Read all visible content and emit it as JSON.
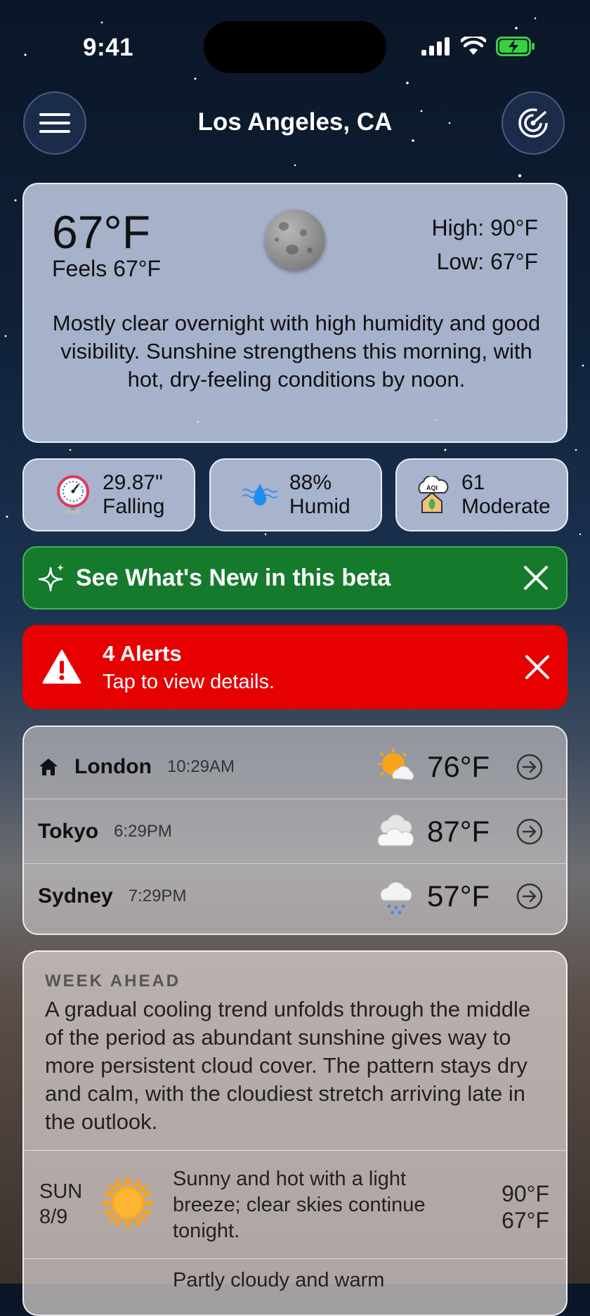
{
  "status": {
    "time": "9:41"
  },
  "header": {
    "city": "Los Angeles, CA"
  },
  "current": {
    "temp": "67°F",
    "feels": "Feels 67°F",
    "high": "High: 90°F",
    "low": "Low: 67°F",
    "summary": "Mostly clear overnight with high humidity and good visibility. Sunshine strengthens this morning, with hot, dry-feeling conditions by noon."
  },
  "metrics": [
    {
      "value": "29.87\"",
      "label": "Falling",
      "icon": "barometer-icon"
    },
    {
      "value": "88%",
      "label": "Humid",
      "icon": "humidity-drop-icon"
    },
    {
      "value": "61",
      "label": "Moderate",
      "icon": "aqi-icon"
    }
  ],
  "aqi_icon_text": "AQI",
  "beta_banner": {
    "text": "See What's New in this beta"
  },
  "alert_banner": {
    "title": "4 Alerts",
    "subtitle": "Tap to view details."
  },
  "cities": [
    {
      "name": "London",
      "time": "10:29AM",
      "temp": "76°F",
      "icon": "partly-sunny-icon",
      "home": true
    },
    {
      "name": "Tokyo",
      "time": "6:29PM",
      "temp": "87°F",
      "icon": "cloudy-icon",
      "home": false
    },
    {
      "name": "Sydney",
      "time": "7:29PM",
      "temp": "57°F",
      "icon": "rain-cloud-icon",
      "home": false
    }
  ],
  "week_ahead": {
    "heading": "WEEK AHEAD",
    "summary": "A gradual cooling trend unfolds through the middle of the period as abundant sunshine gives way to more persistent cloud cover. The pattern stays dry and calm, with the cloudiest stretch arriving late in the outlook.",
    "days": [
      {
        "day": "SUN",
        "date": "8/9",
        "desc": "Sunny and hot with a light breeze; clear skies continue tonight.",
        "high": "90°F",
        "low": "67°F",
        "icon": "sun-icon"
      },
      {
        "desc": "Partly cloudy and warm"
      }
    ]
  },
  "colors": {
    "beta_green": "#157a2c",
    "alert_red": "#e60000",
    "accent_blue": "#1c8ff0"
  }
}
